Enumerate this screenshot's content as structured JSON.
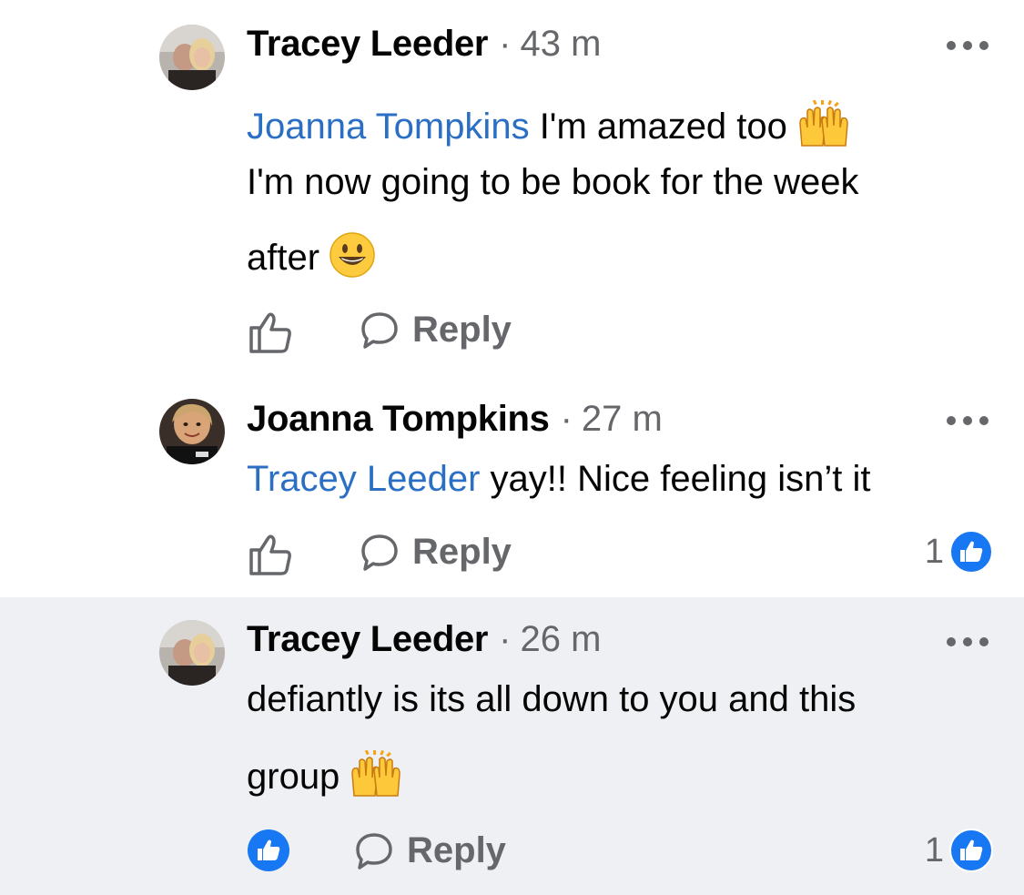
{
  "comments": [
    {
      "author": "Tracey Leeder",
      "separator": "·",
      "time": "43 m",
      "mention": "Joanna Tompkins",
      "lines": [
        " I'm amazed too",
        "I'm now going to be book for the week",
        "after"
      ],
      "reply_label": "Reply",
      "liked": false,
      "reaction_count": ""
    },
    {
      "author": "Joanna Tompkins",
      "separator": "·",
      "time": "27 m",
      "mention": "Tracey Leeder",
      "lines": [
        " yay!! Nice feeling isn’t it"
      ],
      "reply_label": "Reply",
      "liked": false,
      "reaction_count": "1"
    },
    {
      "author": "Tracey Leeder",
      "separator": "·",
      "time": "26 m",
      "mention": "",
      "lines": [
        "defiantly is its all down to you and this",
        "group"
      ],
      "reply_label": "Reply",
      "liked": true,
      "reaction_count": "1"
    }
  ],
  "icons": {
    "like": "thumbs-up-outline-icon",
    "like_filled": "thumbs-up-filled-icon",
    "reply": "speech-bubble-icon",
    "more": "more-dots-icon",
    "raising_hands": "raising-hands-emoji",
    "smiley": "grinning-face-emoji"
  },
  "colors": {
    "mention": "#2b6fc4",
    "secondary_text": "#65676b",
    "like_blue": "#1877f2",
    "highlight_bg": "#eef0f3"
  }
}
